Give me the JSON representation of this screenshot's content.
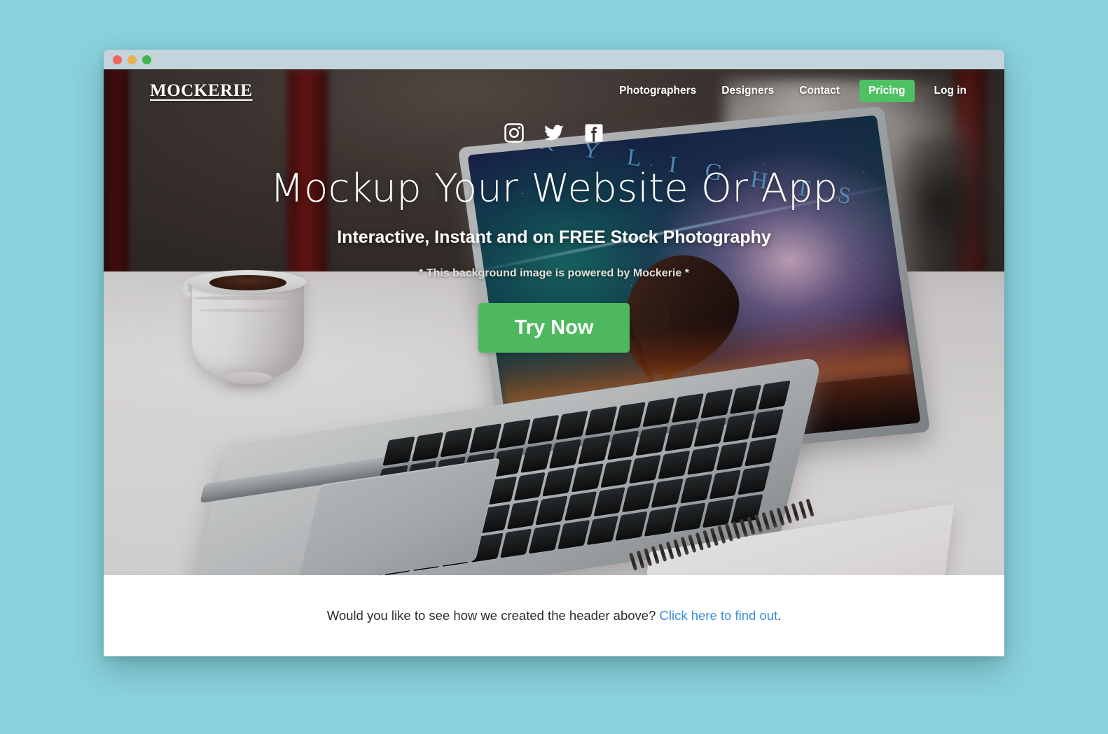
{
  "page": {
    "background_color": "#8ad2dc"
  },
  "window": {
    "titlebar_color": "#c4d4dd",
    "traffic_lights": [
      {
        "name": "close",
        "color": "#f4645f"
      },
      {
        "name": "minimize",
        "color": "#e9b44c"
      },
      {
        "name": "maximize",
        "color": "#3eb44c"
      }
    ]
  },
  "nav": {
    "brand": "MOCKERIE",
    "links": [
      {
        "label": "Photographers",
        "style": "plain"
      },
      {
        "label": "Designers",
        "style": "plain"
      },
      {
        "label": "Contact",
        "style": "plain"
      },
      {
        "label": "Pricing",
        "style": "pill"
      },
      {
        "label": "Log in",
        "style": "plain"
      }
    ],
    "pill_color": "#4ec163"
  },
  "hero": {
    "social": [
      {
        "icon": "instagram-icon"
      },
      {
        "icon": "twitter-icon"
      },
      {
        "icon": "facebook-icon"
      }
    ],
    "title": "Mockup Your Website Or App",
    "subtitle": "Interactive, Instant and on FREE Stock Photography",
    "note": "* This background image is powered by Mockerie *",
    "cta_label": "Try Now",
    "cta_color": "#4eb85f",
    "screen_wallpaper_text": "S K Y L I G H T S"
  },
  "footer": {
    "text_before": "Would you like to see how we created the header above?",
    "link_text": "Click here to find out",
    "text_after": ".",
    "link_color": "#3a8fd8"
  }
}
